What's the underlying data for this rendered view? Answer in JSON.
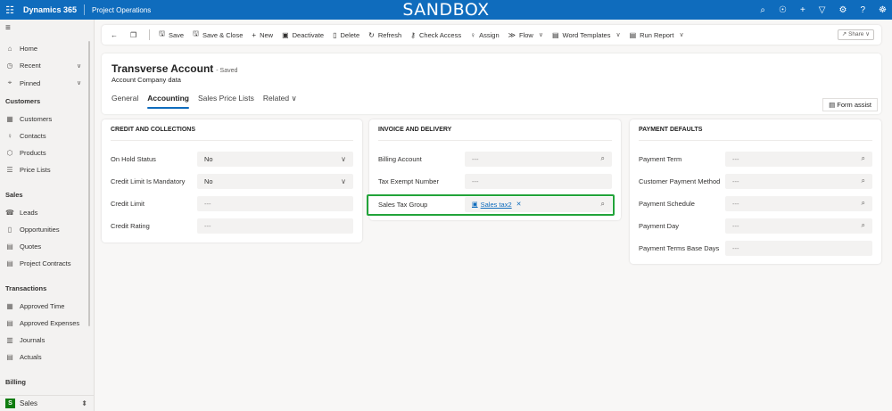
{
  "topbar": {
    "waffle_icon": "waffle-icon",
    "app_name": "Dynamics 365",
    "area_name": "Project Operations",
    "environment": "SANDBOX",
    "icons": [
      "search-icon",
      "lightbulb-icon",
      "plus-icon",
      "filter-icon",
      "settings-icon",
      "help-icon",
      "copilot-icon"
    ],
    "color": "#0f6cbd"
  },
  "sidebar": {
    "menu_icon": "hamburger-icon",
    "top_items": [
      {
        "label": "Home",
        "icon": "home-icon"
      },
      {
        "label": "Recent",
        "icon": "clock-icon"
      },
      {
        "label": "Pinned",
        "icon": "pin-icon"
      }
    ],
    "groups": [
      {
        "title": "Customers",
        "items": [
          {
            "label": "Customers",
            "icon": "building-icon"
          },
          {
            "label": "Contacts",
            "icon": "person-icon"
          },
          {
            "label": "Products",
            "icon": "box-icon"
          },
          {
            "label": "Price Lists",
            "icon": "list-icon"
          }
        ]
      },
      {
        "title": "Sales",
        "items": [
          {
            "label": "Leads",
            "icon": "phone-icon"
          },
          {
            "label": "Opportunities",
            "icon": "document-icon"
          },
          {
            "label": "Quotes",
            "icon": "quote-icon"
          },
          {
            "label": "Project Contracts",
            "icon": "contract-icon"
          }
        ]
      },
      {
        "title": "Transactions",
        "items": [
          {
            "label": "Approved Time",
            "icon": "calendar-icon"
          },
          {
            "label": "Approved Expenses",
            "icon": "receipt-icon"
          },
          {
            "label": "Journals",
            "icon": "journal-icon"
          },
          {
            "label": "Actuals",
            "icon": "report-icon"
          }
        ]
      },
      {
        "title": "Billing",
        "items": []
      }
    ],
    "area_badge": "S",
    "area_label": "Sales"
  },
  "commandbar": {
    "items": [
      {
        "label": "Save",
        "icon": "save-icon"
      },
      {
        "label": "Save & Close",
        "icon": "save-close-icon"
      },
      {
        "label": "New",
        "icon": "plus-icon"
      },
      {
        "label": "Deactivate",
        "icon": "deactivate-icon"
      },
      {
        "label": "Delete",
        "icon": "trash-icon"
      },
      {
        "label": "Refresh",
        "icon": "refresh-icon"
      },
      {
        "label": "Check Access",
        "icon": "key-icon"
      },
      {
        "label": "Assign",
        "icon": "assign-icon"
      },
      {
        "label": "Flow",
        "icon": "flow-icon"
      },
      {
        "label": "Word Templates",
        "icon": "word-icon"
      },
      {
        "label": "Run Report",
        "icon": "report-icon"
      }
    ],
    "share_label": "Share"
  },
  "record": {
    "title": "Transverse Account",
    "saved_status": "- Saved",
    "type": "Account Company data",
    "tabs": [
      "General",
      "Accounting",
      "Sales Price Lists",
      "Related"
    ],
    "active_tab": "Accounting",
    "form_assist": "Form assist"
  },
  "sections": {
    "credit": {
      "title": "CREDIT AND COLLECTIONS",
      "fields": [
        {
          "label": "On Hold Status",
          "value": "No"
        },
        {
          "label": "Credit Limit Is Mandatory",
          "value": "No"
        },
        {
          "label": "Credit Limit",
          "value": "---"
        },
        {
          "label": "Credit Rating",
          "value": "---"
        }
      ]
    },
    "invoice": {
      "title": "INVOICE AND DELIVERY",
      "fields": [
        {
          "label": "Billing Account",
          "value": "---"
        },
        {
          "label": "Tax Exempt Number",
          "value": "---"
        },
        {
          "label": "Sales Tax Group",
          "value": "Sales tax2"
        }
      ]
    },
    "payment": {
      "title": "PAYMENT DEFAULTS",
      "fields": [
        {
          "label": "Payment Term",
          "value": "---"
        },
        {
          "label": "Customer Payment Method",
          "value": "---"
        },
        {
          "label": "Payment Schedule",
          "value": "---"
        },
        {
          "label": "Payment Day",
          "value": "---"
        },
        {
          "label": "Payment Terms Base Days",
          "value": "---"
        }
      ]
    }
  },
  "highlight_color": "#22a43a"
}
